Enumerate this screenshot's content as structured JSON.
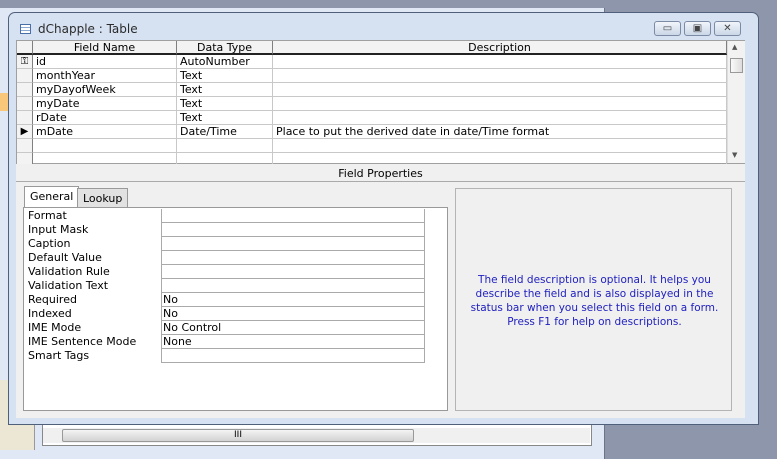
{
  "window": {
    "title": "dChapple : Table",
    "buttons": {
      "minimize": "▭",
      "restore": "▣",
      "close": "✕"
    }
  },
  "grid": {
    "headers": [
      "Field Name",
      "Data Type",
      "Description"
    ],
    "rows": [
      {
        "name": "id",
        "type": "AutoNumber",
        "description": "",
        "selector": "key-icon"
      },
      {
        "name": "monthYear",
        "type": "Text",
        "description": ""
      },
      {
        "name": "myDayofWeek",
        "type": "Text",
        "description": ""
      },
      {
        "name": "myDate",
        "type": "Text",
        "description": ""
      },
      {
        "name": "rDate",
        "type": "Text",
        "description": ""
      },
      {
        "name": "mDate",
        "type": "Date/Time",
        "description": "Place to put the derived date in date/Time format",
        "selector": "current-row-arrow"
      }
    ]
  },
  "field_properties": {
    "label": "Field Properties",
    "tabs": [
      "General",
      "Lookup"
    ],
    "active_tab": "General",
    "properties": [
      {
        "label": "Format",
        "value": ""
      },
      {
        "label": "Input Mask",
        "value": ""
      },
      {
        "label": "Caption",
        "value": ""
      },
      {
        "label": "Default Value",
        "value": ""
      },
      {
        "label": "Validation Rule",
        "value": ""
      },
      {
        "label": "Validation Text",
        "value": ""
      },
      {
        "label": "Required",
        "value": "No"
      },
      {
        "label": "Indexed",
        "value": "No"
      },
      {
        "label": "IME Mode",
        "value": "No Control"
      },
      {
        "label": "IME Sentence Mode",
        "value": "None"
      },
      {
        "label": "Smart Tags",
        "value": ""
      }
    ],
    "help_text": "The field description is optional.  It helps you describe the field and is also displayed in the status bar when you select this field on a form.  Press F1 for help on descriptions."
  },
  "background": {
    "scroll_thumb": "III"
  }
}
